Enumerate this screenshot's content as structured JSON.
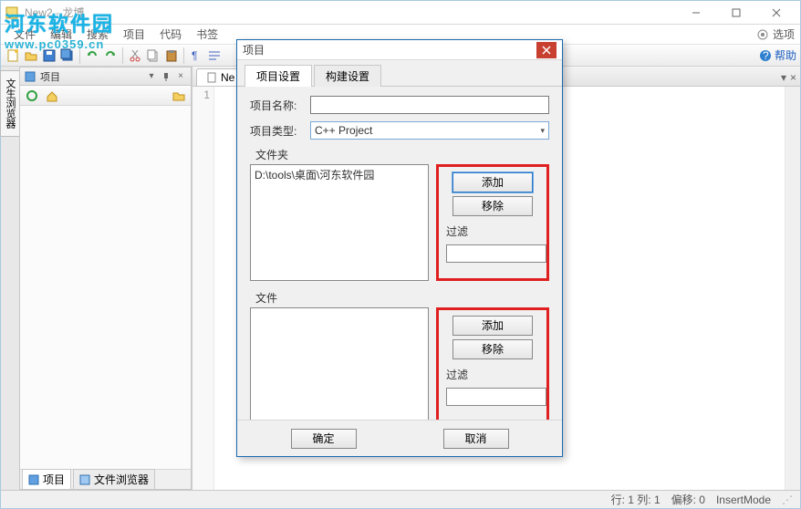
{
  "titlebar": {
    "text": "New2 - 龙博"
  },
  "watermark": {
    "line1": "河东软件园",
    "line2": "www.pc0359.cn"
  },
  "menu": {
    "items": [
      "文件",
      "编辑",
      "搜索",
      "项目",
      "代码",
      "书签"
    ],
    "options": "选项"
  },
  "toolbar": {
    "help": "帮助"
  },
  "panel": {
    "title": "项目",
    "footer_tabs": [
      "项目",
      "文件浏览器"
    ]
  },
  "editor": {
    "tab": "Ne",
    "first_line": "1"
  },
  "dialog": {
    "title": "项目",
    "tabs": [
      "项目设置",
      "构建设置"
    ],
    "name_label": "项目名称:",
    "name_value": "",
    "type_label": "项目类型:",
    "type_value": "C++ Project",
    "folders_label": "文件夹",
    "folders_item": "D:\\tools\\桌面\\河东软件园",
    "files_label": "文件",
    "add": "添加",
    "remove": "移除",
    "filter": "过滤",
    "ok": "确定",
    "cancel": "取消"
  },
  "status": {
    "pos": "行: 1  列: 1",
    "offset": "偏移: 0",
    "mode": "InsertMode"
  }
}
